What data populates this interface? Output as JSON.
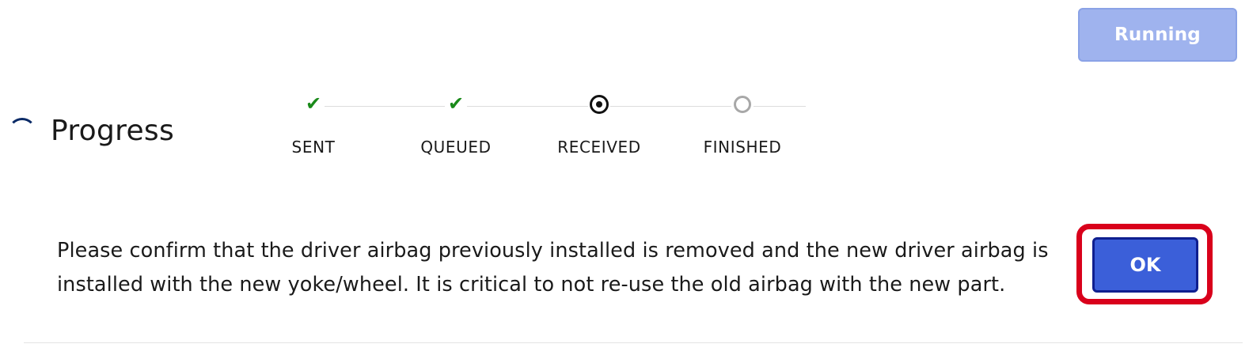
{
  "toolbar": {
    "run_status_label": "Running"
  },
  "progress": {
    "title": "Progress",
    "spinner_icon": "spinner-icon",
    "steps": [
      {
        "label": "SENT",
        "state": "complete",
        "icon": "check-icon"
      },
      {
        "label": "QUEUED",
        "state": "complete",
        "icon": "check-icon"
      },
      {
        "label": "RECEIVED",
        "state": "current",
        "icon": "radio-dot-icon"
      },
      {
        "label": "FINISHED",
        "state": "pending",
        "icon": "empty-circle-icon"
      }
    ]
  },
  "prompt": {
    "message": "Please confirm that the driver airbag previously installed is removed and the new driver airbag is installed with the new yoke/wheel. It is critical to not re-use the old airbag with the new part.",
    "ok_label": "OK"
  },
  "colors": {
    "running_button_bg": "#9fb3ee",
    "ok_button_bg": "#3b5fd9",
    "highlight_border": "#d9001b",
    "check_green": "#1a8a1a"
  }
}
